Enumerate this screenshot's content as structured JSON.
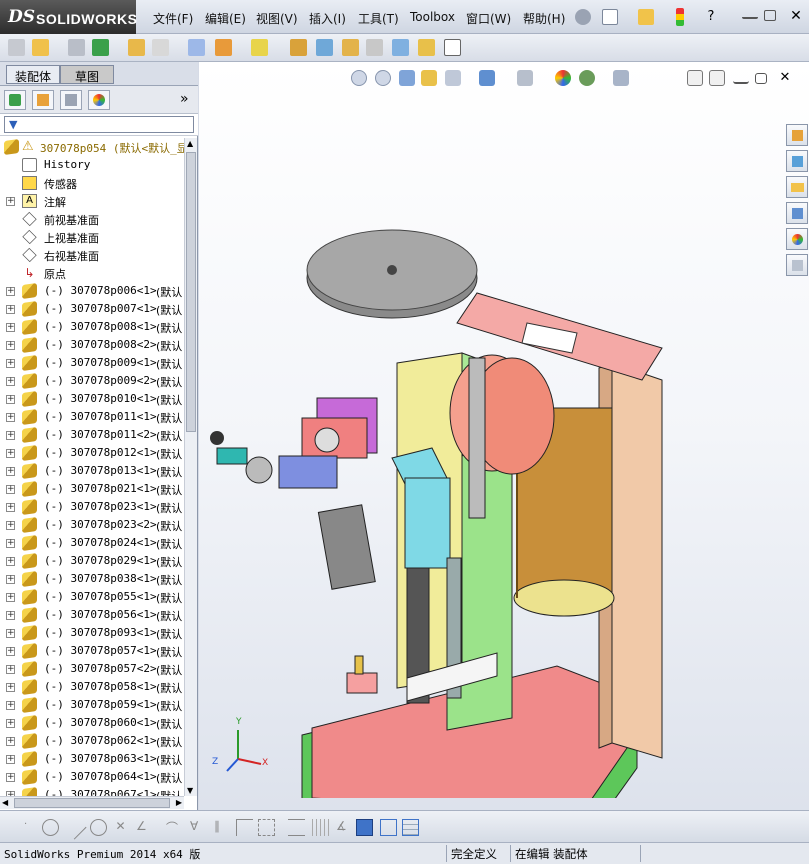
{
  "app": {
    "brand_ds": "DS",
    "brand_name": "SOLIDWORKS"
  },
  "menu": [
    "文件(F)",
    "编辑(E)",
    "视图(V)",
    "插入(I)",
    "工具(T)",
    "Toolbox",
    "窗口(W)",
    "帮助(H)"
  ],
  "panel": {
    "tab_assembly": "装配体",
    "tab_sketch": "草图",
    "more_label": "»",
    "root": "307078p054  (默认<默认_显",
    "items": [
      {
        "label": "History",
        "type": "history"
      },
      {
        "label": "传感器",
        "type": "sensor"
      },
      {
        "label": "注解",
        "type": "annotation"
      },
      {
        "label": "前视基准面",
        "type": "plane"
      },
      {
        "label": "上视基准面",
        "type": "plane"
      },
      {
        "label": "右视基准面",
        "type": "plane"
      },
      {
        "label": "原点",
        "type": "origin"
      }
    ],
    "components": [
      {
        "name": "(-) 307078p006<1>",
        "cfg": "(默认"
      },
      {
        "name": "(-) 307078p007<1>",
        "cfg": "(默认"
      },
      {
        "name": "(-) 307078p008<1>",
        "cfg": "(默认"
      },
      {
        "name": "(-) 307078p008<2>",
        "cfg": "(默认"
      },
      {
        "name": "(-) 307078p009<1>",
        "cfg": "(默认"
      },
      {
        "name": "(-) 307078p009<2>",
        "cfg": "(默认"
      },
      {
        "name": "(-) 307078p010<1>",
        "cfg": "(默认"
      },
      {
        "name": "(-) 307078p011<1>",
        "cfg": "(默认"
      },
      {
        "name": "(-) 307078p011<2>",
        "cfg": "(默认"
      },
      {
        "name": "(-) 307078p012<1>",
        "cfg": "(默认"
      },
      {
        "name": "(-) 307078p013<1>",
        "cfg": "(默认"
      },
      {
        "name": "(-) 307078p021<1>",
        "cfg": "(默认"
      },
      {
        "name": "(-) 307078p023<1>",
        "cfg": "(默认"
      },
      {
        "name": "(-) 307078p023<2>",
        "cfg": "(默认"
      },
      {
        "name": "(-) 307078p024<1>",
        "cfg": "(默认"
      },
      {
        "name": "(-) 307078p029<1>",
        "cfg": "(默认"
      },
      {
        "name": "(-) 307078p038<1>",
        "cfg": "(默认"
      },
      {
        "name": "(-) 307078p055<1>",
        "cfg": "(默认"
      },
      {
        "name": "(-) 307078p056<1>",
        "cfg": "(默认"
      },
      {
        "name": "(-) 307078p093<1>",
        "cfg": "(默认"
      },
      {
        "name": "(-) 307078p057<1>",
        "cfg": "(默认"
      },
      {
        "name": "(-) 307078p057<2>",
        "cfg": "(默认"
      },
      {
        "name": "(-) 307078p058<1>",
        "cfg": "(默认"
      },
      {
        "name": "(-) 307078p059<1>",
        "cfg": "(默认"
      },
      {
        "name": "(-) 307078p060<1>",
        "cfg": "(默认"
      },
      {
        "name": "(-) 307078p062<1>",
        "cfg": "(默认"
      },
      {
        "name": "(-) 307078p063<1>",
        "cfg": "(默认"
      },
      {
        "name": "(-) 307078p064<1>",
        "cfg": "(默认"
      },
      {
        "name": "(-) 307078p067<1>",
        "cfg": "(默认"
      }
    ]
  },
  "triad": {
    "x": "X",
    "y": "Y",
    "z": "Z"
  },
  "status": {
    "product": "SolidWorks Premium 2014 x64 版",
    "definition": "完全定义",
    "mode": "在编辑 装配体"
  },
  "colors": {
    "accent": "#e31b23",
    "panel_bg": "#ffffff",
    "frame": "#d6dbe6"
  }
}
